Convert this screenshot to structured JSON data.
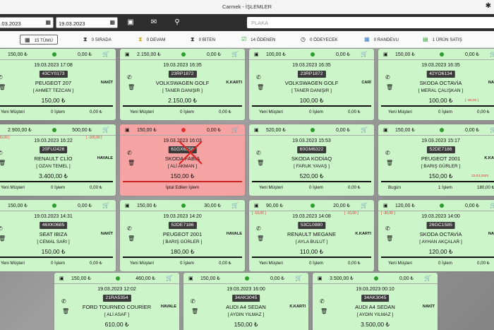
{
  "window": {
    "title": "Carmek - İŞLEMLER"
  },
  "toolbar": {
    "date_from": "19.03.2023",
    "date_to": "19.03.2023",
    "plate_placeholder": "PLAKA"
  },
  "filters": [
    {
      "label": "15  TÜMÜ",
      "icon": "grid-icon"
    },
    {
      "label": "0  SIRADA",
      "icon": "hourglass-icon"
    },
    {
      "label": "0  DEVAM",
      "icon": "hourglass-half-icon"
    },
    {
      "label": "0  BİTEN",
      "icon": "hourglass-end-icon"
    },
    {
      "label": "14  ÖDENEN",
      "icon": "check-icon"
    },
    {
      "label": "0  ÖDEYECEK",
      "icon": "clock-icon"
    },
    {
      "label": "0  RANDEVU",
      "icon": "calendar-icon"
    },
    {
      "label": "1  ÜRÜN SATIŞ",
      "icon": "cart-icon"
    }
  ],
  "colors": {
    "card_green": "#ccf5c9",
    "card_red": "#f5a3a3",
    "status_green": "#2a9d2a",
    "status_red": "#e53030"
  },
  "cards": [
    {
      "left_amount": "150,00 ₺",
      "right_amount": "0,00 ₺",
      "date": "19.03.2023 17:08",
      "plate": "43CY0173",
      "model": "PEUGEOT 207",
      "payment": "NAKİT",
      "customer": "[ AHMET TEZCAN ]",
      "price": "150,00 ₺",
      "footer_left": "Yeni Müşteri",
      "footer_mid": "0 İşlem",
      "footer_right": "0,00 ₺"
    },
    {
      "left_amount": "2.150,00 ₺",
      "right_amount": "0,00 ₺",
      "date": "19.03.2023 16:35",
      "plate": "23RP1872",
      "model": "VOLKSWAGEN GOLF",
      "payment": "K.KARTI",
      "customer": "[ TANER DANIŞIR ]",
      "price": "2.150,00 ₺",
      "footer_left": "Yeni Müşteri",
      "footer_mid": "0 İşlem",
      "footer_right": "0,00 ₺"
    },
    {
      "left_amount": "100,00 ₺",
      "right_amount": "0,00 ₺",
      "date": "19.03.2023 16:35",
      "plate": "23RP1872",
      "model": "VOLKSWAGEN GOLF",
      "payment": "CARİ",
      "customer": "[ TANER DANIŞIR ]",
      "price": "100,00 ₺",
      "footer_left": "Yeni Müşteri",
      "footer_mid": "0 İşlem",
      "footer_right": "0,00 ₺"
    },
    {
      "left_amount": "150,00 ₺",
      "right_amount": "0,00 ₺",
      "date": "19.03.2023 16:35",
      "plate": "42YO6134",
      "model": "SKODA OCTAVİA",
      "payment": "NAKİT",
      "customer": "[ MERAL ÇALIŞKAN ]",
      "price": "100,00 ₺",
      "old_price": "[ -50,00 ]",
      "footer_left": "Yeni Müşteri",
      "footer_mid": "0 İşlem",
      "footer_right": "0,00 ₺"
    },
    {
      "left_amount": "2.900,00 ₺",
      "right_amount": "500,00 ₺",
      "sub_left": "[ -100,00 ]",
      "sub_right": "[ -100,00 ]",
      "date": "19.03.2023 16:22",
      "plate": "20FU2426",
      "model": "RENAULT CLİO",
      "payment": "HAVALE",
      "customer": "[ OZAN TEMEL ]",
      "price": "3.400,00 ₺",
      "footer_left": "Yeni Müşteri",
      "footer_mid": "0 İşlem",
      "footer_right": "0,00 ₺"
    },
    {
      "left_amount": "150,00 ₺",
      "right_amount": "0,00 ₺",
      "date": "19.03.2023 16:03",
      "plate": "61GX6558",
      "model": "SKODA FABİA",
      "payment": "",
      "customer": "[ ALİ AKMAN ]",
      "price": "150,00 ₺",
      "footer_center": "İptal Edilen İşlem",
      "cancelled": true
    },
    {
      "left_amount": "520,00 ₺",
      "right_amount": "0,00 ₺",
      "date": "19.03.2023 15:53",
      "plate": "60GM6322",
      "model": "SKODA KODİAQ",
      "payment": "",
      "customer": "[ FARUK YAVAŞ ]",
      "price": "520,00 ₺",
      "footer_left": "Yeni Müşteri",
      "footer_mid": "0 İşlem",
      "footer_right": "0,00 ₺"
    },
    {
      "left_amount": "150,00 ₺",
      "right_amount": "0,00 ₺",
      "date": "19.03.2023 15:17",
      "plate": "52DE7186",
      "model": "PEUGEOT 2001",
      "payment": "K.KARTI",
      "customer": "[ BARIŞ GÜRLER ]",
      "price": "150,00 ₺",
      "price_date": "23.03.2023",
      "footer_left": "Bugün",
      "footer_mid": "1 İşlem",
      "footer_right": "180,00 ₺"
    },
    {
      "left_amount": "150,00 ₺",
      "right_amount": "0,00 ₺",
      "date": "19.03.2023 14:31",
      "plate": "46XK0685",
      "model": "SEAT IBIZA",
      "payment": "NAKİT",
      "customer": "[ CEMAL SARI ]",
      "price": "150,00 ₺",
      "footer_left": "Yeni Müşteri",
      "footer_mid": "0 İşlem",
      "footer_right": "0,00 ₺"
    },
    {
      "left_amount": "150,00 ₺",
      "right_amount": "30,00 ₺",
      "date": "19.03.2023 14:20",
      "plate": "52DE7186",
      "model": "PEUGEOT 2001",
      "payment": "HAVALE",
      "customer": "[ BARIŞ GÜRLER ]",
      "price": "180,00 ₺",
      "footer_left": "Yeni Müşteri",
      "footer_mid": "0 İşlem",
      "footer_right": "0,00 ₺"
    },
    {
      "left_amount": "90,00 ₺",
      "right_amount": "20,00 ₺",
      "sub_left": "[ -10,00 ]",
      "sub_right": "[ -10,00 ]",
      "date": "19.03.2023 14:08",
      "plate": "53CL0880",
      "model": "RENAULT MEGANE",
      "payment": "K.KARTI",
      "customer": "[ AYLA BULUT ]",
      "price": "110,00 ₺",
      "footer_left": "Yeni Müşteri",
      "footer_mid": "0 İşlem",
      "footer_right": "0,00 ₺"
    },
    {
      "left_amount": "120,00 ₺",
      "right_amount": "0,00 ₺",
      "sub_left": "[ -30,00 ]",
      "date": "19.03.2023 14:00",
      "plate": "26GC1585",
      "model": "SKODA OCTAVİA",
      "payment": "NAKİT",
      "customer": "[ AYHAN AKÇALAR ]",
      "price": "120,00 ₺",
      "footer_left": "Yeni Müşteri",
      "footer_mid": "0 İşlem",
      "footer_right": "0,00 ₺"
    },
    {
      "left_amount": "150,00 ₺",
      "right_amount": "460,00 ₺",
      "date": "19.03.2023 12:02",
      "plate": "21RA5354",
      "model": "FORD TOURNEO COURİER",
      "payment": "HAVALE",
      "customer": "[ ALİ ASAF ]",
      "price": "610,00 ₺"
    },
    {
      "left_amount": "150,00 ₺",
      "right_amount": "0,00 ₺",
      "date": "19.03.2023 16:00",
      "plate": "34AK3045",
      "model": "AUDI A4 SEDAN",
      "payment": "K.KARTI",
      "customer": "[ AYDIN YILMAZ ]",
      "price": "150,00 ₺"
    },
    {
      "left_amount": "3.500,00 ₺",
      "right_amount": "0,00 ₺",
      "date": "19.03.2023 00:10",
      "plate": "34AK3045",
      "model": "AUDI A4 SEDAN",
      "payment": "NAKİT",
      "customer": "[ AYDIN YILMAZ ]",
      "price": "3.500,00 ₺"
    }
  ]
}
